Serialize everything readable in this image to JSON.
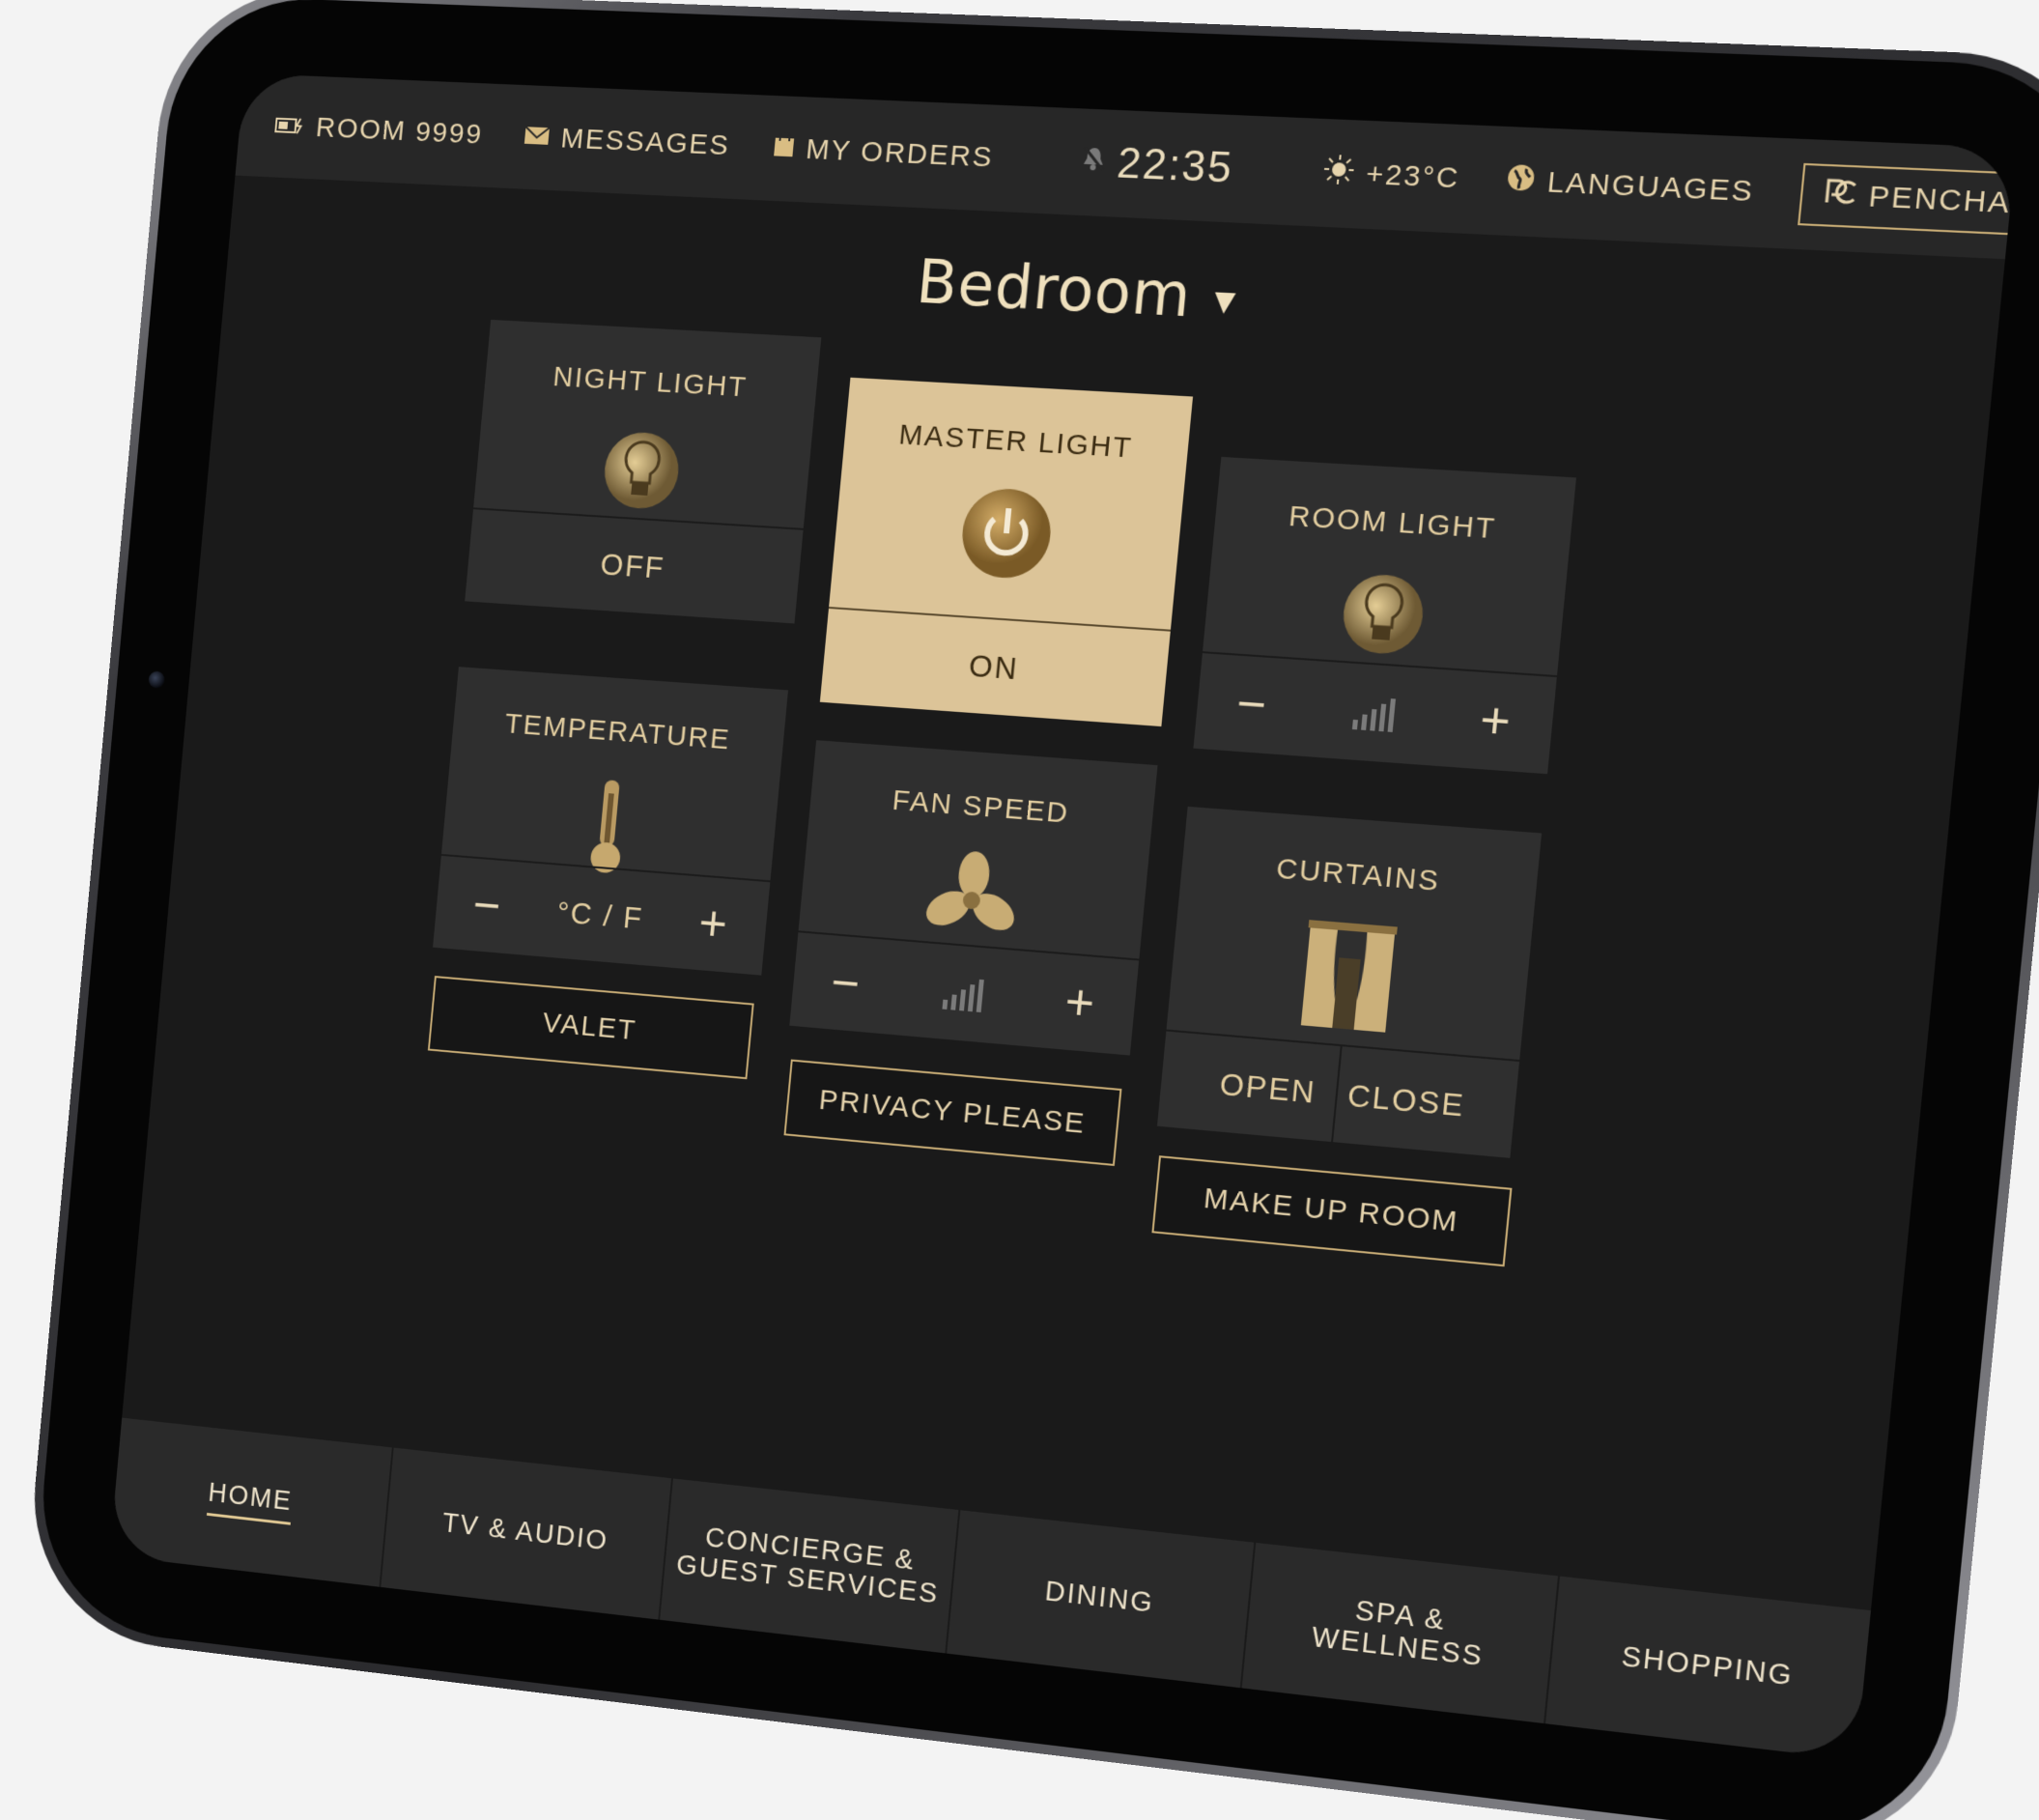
{
  "statusbar": {
    "room": "ROOM 9999",
    "messages": "MESSAGES",
    "orders": "MY ORDERS",
    "time": "22:35",
    "temperature": "+23°C",
    "languages": "LANGUAGES",
    "penchat": "PENCHAT"
  },
  "room_selector": {
    "label": "Bedroom"
  },
  "tiles": {
    "night_light": {
      "label": "NIGHT LIGHT",
      "state": "OFF"
    },
    "master_light": {
      "label": "MASTER LIGHT",
      "state": "ON"
    },
    "room_light": {
      "label": "ROOM LIGHT",
      "minus": "−",
      "plus": "+"
    },
    "temperature": {
      "label": "TEMPERATURE",
      "unit": "°C / F",
      "minus": "−",
      "plus": "+"
    },
    "fan_speed": {
      "label": "FAN SPEED",
      "minus": "−",
      "plus": "+"
    },
    "curtains": {
      "label": "CURTAINS",
      "open": "OPEN",
      "close": "CLOSE"
    }
  },
  "actions": {
    "valet": "VALET",
    "privacy": "PRIVACY PLEASE",
    "makeup": "MAKE UP ROOM"
  },
  "nav": {
    "home": "HOME",
    "tv": "TV & AUDIO",
    "concierge_1": "CONCIERGE &",
    "concierge_2": "GUEST SERVICES",
    "dining": "DINING",
    "spa_1": "SPA &",
    "spa_2": "WELLNESS",
    "shopping": "SHOPPING"
  },
  "colors": {
    "accent": "#dcc498",
    "gold_text": "#e4cfa1",
    "tile_bg": "#2f2f2f",
    "screen_bg": "#1a1a1a"
  },
  "icons": {
    "battery": "battery-icon",
    "messages": "envelope-icon",
    "orders": "bag-icon",
    "alarm": "bell-off-icon",
    "weather": "sun-icon",
    "languages": "globe-icon",
    "penchat": "penchat-logo-icon"
  }
}
